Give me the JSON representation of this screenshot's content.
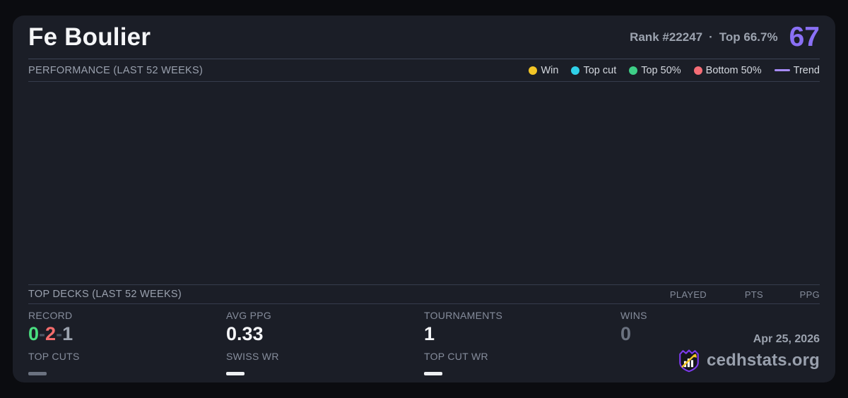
{
  "header": {
    "title": "Fe Boulier",
    "rank": "Rank #22247",
    "separator": "·",
    "top_percent": "Top 66.7%",
    "score": "67",
    "score_color": "#8a70f5"
  },
  "performance": {
    "header": "PERFORMANCE (LAST 52 WEEKS)",
    "legend": [
      {
        "label": "Win",
        "color": "#f2c526"
      },
      {
        "label": "Top cut",
        "color": "#2fd0e8"
      },
      {
        "label": "Top 50%",
        "color": "#3ecf87"
      },
      {
        "label": "Bottom 50%",
        "color": "#f56d76"
      },
      {
        "label": "Trend",
        "color": "#a78bfa"
      }
    ]
  },
  "top_decks": {
    "header": "TOP DECKS (LAST 52 WEEKS)",
    "columns": {
      "played": "PLAYED",
      "pts": "PTS",
      "ppg": "PPG"
    }
  },
  "stats": {
    "record": {
      "label": "RECORD",
      "wins": "0",
      "losses": "2",
      "draws": "1",
      "separator": "-"
    },
    "avg_ppg": {
      "label": "AVG PPG",
      "value": "0.33"
    },
    "tournaments": {
      "label": "TOURNAMENTS",
      "value": "1"
    },
    "wins": {
      "label": "WINS",
      "value": "0"
    },
    "top_cuts": {
      "label": "TOP CUTS"
    },
    "swiss_wr": {
      "label": "SWISS WR"
    },
    "top_cut_wr": {
      "label": "TOP CUT WR"
    }
  },
  "footer": {
    "date": "Apr 25, 2026",
    "brand": "cedhstats.org"
  }
}
